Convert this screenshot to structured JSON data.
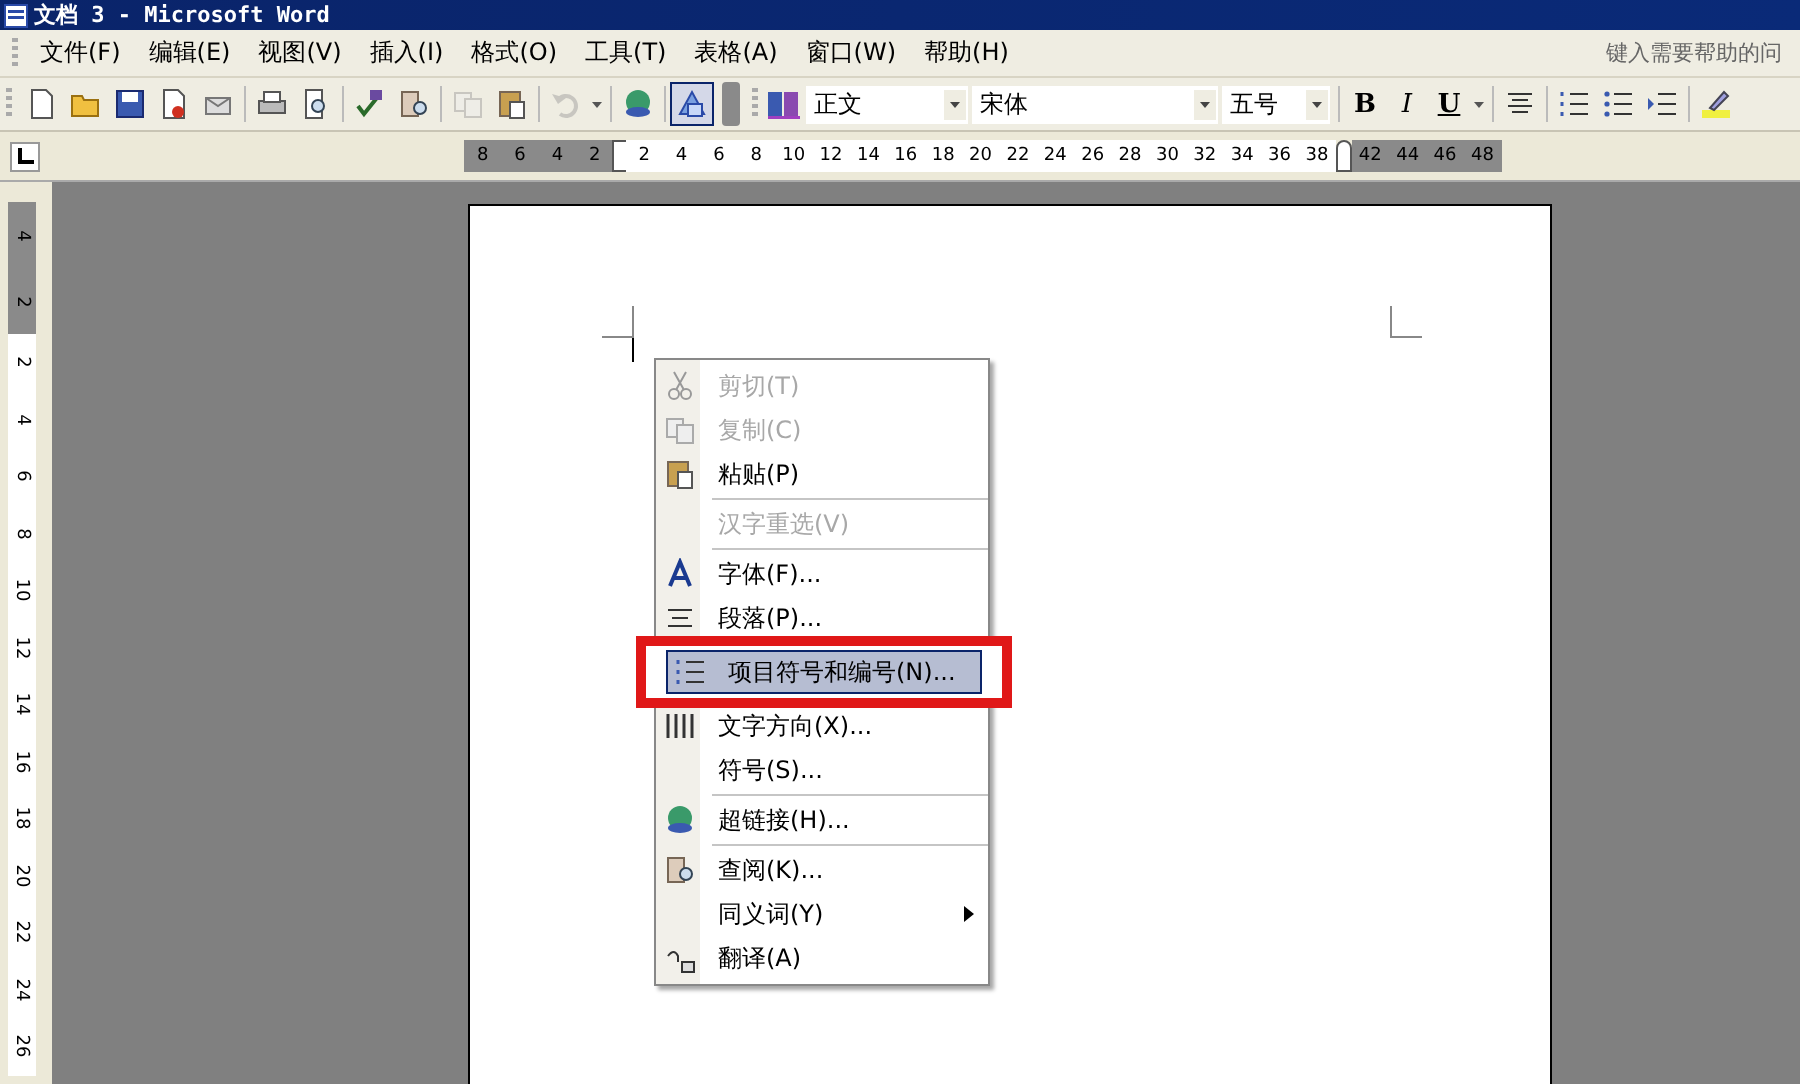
{
  "window": {
    "title": "文档 3 - Microsoft Word"
  },
  "menu_bar": {
    "items": [
      {
        "label": "文件(F)"
      },
      {
        "label": "编辑(E)"
      },
      {
        "label": "视图(V)"
      },
      {
        "label": "插入(I)"
      },
      {
        "label": "格式(O)"
      },
      {
        "label": "工具(T)"
      },
      {
        "label": "表格(A)"
      },
      {
        "label": "窗口(W)"
      },
      {
        "label": "帮助(H)"
      }
    ],
    "help_box": {
      "placeholder": "键入需要帮助的问"
    }
  },
  "toolbar": {
    "buttons": [
      {
        "pressed": false,
        "disabled": false
      },
      {
        "pressed": false,
        "disabled": false
      },
      {
        "pressed": false,
        "disabled": false
      },
      {
        "pressed": false,
        "disabled": false
      },
      {
        "pressed": false,
        "disabled": false
      },
      {
        "pressed": false,
        "disabled": false
      },
      {
        "pressed": false,
        "disabled": false
      },
      {
        "pressed": false,
        "disabled": false
      },
      {
        "pressed": false,
        "disabled": false
      },
      {
        "pressed": false,
        "disabled": true
      },
      {
        "pressed": false,
        "disabled": false
      },
      {
        "pressed": false,
        "disabled": true
      },
      {
        "pressed": false,
        "disabled": false
      },
      {
        "pressed": true,
        "disabled": false
      }
    ],
    "style": "正文",
    "font": "宋体",
    "size": "五号",
    "format_buttons": [
      {
        "kind": "bold",
        "label": "B"
      },
      {
        "kind": "italic",
        "label": "I"
      },
      {
        "kind": "underline",
        "label": "U"
      }
    ]
  },
  "ruler": {
    "ticks": [
      {
        "label": "8",
        "margin": true
      },
      {
        "label": "6",
        "margin": true
      },
      {
        "label": "4",
        "margin": true
      },
      {
        "label": "2",
        "margin": true
      },
      {
        "label": "2",
        "margin": false
      },
      {
        "label": "4",
        "margin": false
      },
      {
        "label": "6",
        "margin": false
      },
      {
        "label": "8",
        "margin": false
      },
      {
        "label": "10",
        "margin": false
      },
      {
        "label": "12",
        "margin": false
      },
      {
        "label": "14",
        "margin": false
      },
      {
        "label": "16",
        "margin": false
      },
      {
        "label": "18",
        "margin": false
      },
      {
        "label": "20",
        "margin": false
      },
      {
        "label": "22",
        "margin": false
      },
      {
        "label": "24",
        "margin": false
      },
      {
        "label": "26",
        "margin": false
      },
      {
        "label": "28",
        "margin": false
      },
      {
        "label": "30",
        "margin": false
      },
      {
        "label": "32",
        "margin": false
      },
      {
        "label": "34",
        "margin": false
      },
      {
        "label": "36",
        "margin": false
      },
      {
        "label": "38",
        "margin": false
      },
      {
        "label": "42",
        "margin": true
      },
      {
        "label": "44",
        "margin": true
      },
      {
        "label": "46",
        "margin": true
      },
      {
        "label": "48",
        "margin": true
      }
    ]
  },
  "vertical_ruler": {
    "ticks": [
      {
        "label": "4",
        "margin": true
      },
      {
        "label": "2",
        "margin": true
      },
      {
        "label": "2",
        "margin": false
      },
      {
        "label": "4",
        "margin": false
      },
      {
        "label": "6",
        "margin": false
      },
      {
        "label": "8",
        "margin": false
      },
      {
        "label": "10",
        "margin": false
      },
      {
        "label": "12",
        "margin": false
      },
      {
        "label": "14",
        "margin": false
      },
      {
        "label": "16",
        "margin": false
      },
      {
        "label": "18",
        "margin": false
      },
      {
        "label": "20",
        "margin": false
      },
      {
        "label": "22",
        "margin": false
      },
      {
        "label": "24",
        "margin": false
      },
      {
        "label": "26",
        "margin": false
      }
    ]
  },
  "context_menu": {
    "items": [
      {
        "kind": "item",
        "label": "剪切(T)",
        "disabled": true,
        "selected": false,
        "submenu": false
      },
      {
        "kind": "item",
        "label": "复制(C)",
        "disabled": true,
        "selected": false,
        "submenu": false
      },
      {
        "kind": "item",
        "label": "粘贴(P)",
        "disabled": false,
        "selected": false,
        "submenu": false
      },
      {
        "kind": "separator"
      },
      {
        "kind": "item",
        "label": "汉字重选(V)",
        "disabled": true,
        "selected": false,
        "submenu": false
      },
      {
        "kind": "separator"
      },
      {
        "kind": "item",
        "label": "字体(F)...",
        "disabled": false,
        "selected": false,
        "submenu": false
      },
      {
        "kind": "item",
        "label": "段落(P)...",
        "disabled": false,
        "selected": false,
        "submenu": false
      },
      {
        "kind": "item",
        "label": "项目符号和编号(N)...",
        "disabled": false,
        "selected": true,
        "submenu": false
      },
      {
        "kind": "item",
        "label": "文字方向(X)...",
        "disabled": false,
        "selected": false,
        "submenu": false
      },
      {
        "kind": "item",
        "label": "符号(S)...",
        "disabled": false,
        "selected": false,
        "submenu": false
      },
      {
        "kind": "separator"
      },
      {
        "kind": "item",
        "label": "超链接(H)...",
        "disabled": false,
        "selected": false,
        "submenu": false
      },
      {
        "kind": "separator"
      },
      {
        "kind": "item",
        "label": "查阅(K)...",
        "disabled": false,
        "selected": false,
        "submenu": false
      },
      {
        "kind": "item",
        "label": "同义词(Y)",
        "disabled": false,
        "selected": false,
        "submenu": true
      },
      {
        "kind": "item",
        "label": "翻译(A)",
        "disabled": false,
        "selected": false,
        "submenu": false
      }
    ]
  }
}
